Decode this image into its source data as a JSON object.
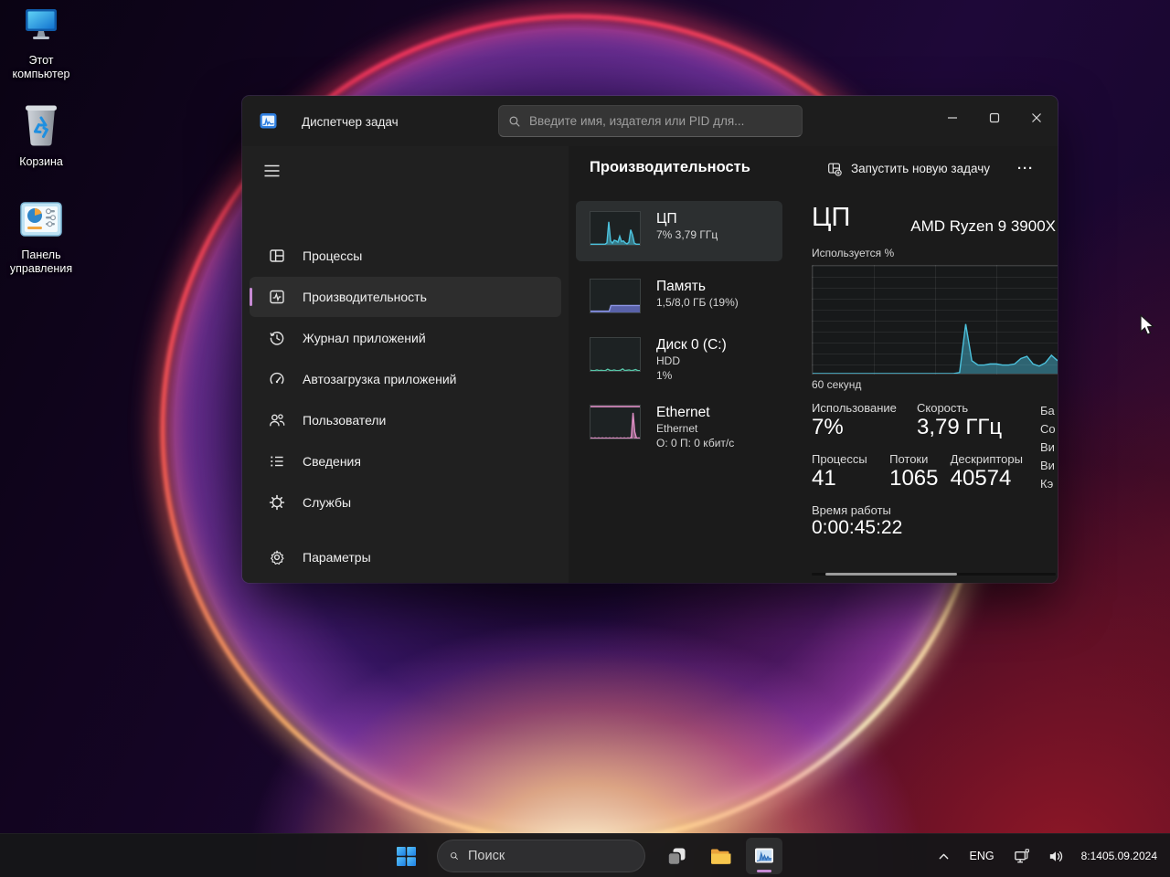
{
  "accent": "#c78ad4",
  "colors": {
    "cpu": "#4cc2dd",
    "memory": "#7c85db",
    "disk": "#57c6a8",
    "ethernet": "#e08fc6"
  },
  "desktop": {
    "icons": [
      {
        "label": "Этот компьютер"
      },
      {
        "label": "Корзина"
      },
      {
        "label": "Панель управления"
      }
    ]
  },
  "tm": {
    "title": "Диспетчер задач",
    "search_placeholder": "Введите имя, издателя или PID для...",
    "nav": {
      "items": [
        {
          "label": "Процессы"
        },
        {
          "label": "Производительность"
        },
        {
          "label": "Журнал приложений"
        },
        {
          "label": "Автозагрузка приложений"
        },
        {
          "label": "Пользователи"
        },
        {
          "label": "Сведения"
        },
        {
          "label": "Службы"
        }
      ],
      "settings": "Параметры"
    },
    "header": {
      "title": "Производительность",
      "new_task": "Запустить новую задачу",
      "more": "···"
    },
    "cards": [
      {
        "title": "ЦП",
        "line2": "7% 3,79 ГГц"
      },
      {
        "title": "Память",
        "line2": "1,5/8,0 ГБ (19%)"
      },
      {
        "title": "Диск 0 (C:)",
        "line2": "HDD",
        "line3": "1%"
      },
      {
        "title": "Ethernet",
        "line2": "Ethernet",
        "line3": "О: 0 П: 0 кбит/с"
      }
    ],
    "cpu": {
      "title": "ЦП",
      "subtitle": "AMD Ryzen 9 3900X",
      "y_label": "Используется %",
      "x_label": "60 секунд",
      "stats": {
        "usage_label": "Использование",
        "usage": "7%",
        "speed_label": "Скорость",
        "speed": "3,79 ГГц",
        "processes_label": "Процессы",
        "processes": "41",
        "threads_label": "Потоки",
        "threads": "1065",
        "handles_label": "Дескрипторы",
        "handles": "40574",
        "uptime_label": "Время работы",
        "uptime": "0:00:45:22"
      },
      "clipped_labels": [
        "Ба",
        "Со",
        "Ви",
        "Ви",
        "Кэ"
      ]
    }
  },
  "taskbar": {
    "search_placeholder": "Поиск",
    "lang": "ENG",
    "time": "8:14",
    "date": "05.09.2024"
  },
  "chart_data": [
    {
      "id": "cpu-main",
      "type": "area",
      "title": "ЦП — Используется %",
      "xlabel": "60 секунд",
      "ylabel": "Используется %",
      "ylim": [
        0,
        100
      ],
      "grid": true,
      "color": "#4cc2dd",
      "fill": "rgba(76,194,221,0.45)",
      "ymax": 100,
      "values": [
        0,
        0,
        0,
        0,
        0,
        0,
        0,
        0,
        0,
        0,
        0,
        0,
        0,
        0,
        0,
        0,
        0,
        0,
        0,
        0,
        0,
        0,
        0,
        0,
        1,
        46,
        12,
        8,
        8,
        9,
        9,
        8,
        8,
        9,
        14,
        16,
        9,
        7,
        10,
        17,
        12
      ]
    },
    {
      "id": "cpu-mini",
      "type": "area",
      "title": "ЦП 7% 3,79 ГГц",
      "ylim": [
        0,
        100
      ],
      "color": "#4cc2dd",
      "fill": "rgba(76,194,221,0.55)",
      "ymax": 100,
      "values": [
        2,
        2,
        2,
        2,
        2,
        2,
        2,
        2,
        2,
        6,
        70,
        12,
        5,
        14,
        12,
        8,
        26,
        10,
        12,
        6,
        3,
        8,
        46,
        30,
        5,
        2,
        2,
        2
      ]
    },
    {
      "id": "memory-mini",
      "type": "area",
      "title": "Память 1,5/8,0 ГБ (19%)",
      "ylim": [
        0,
        100
      ],
      "color": "#8e97e8",
      "fill": "rgba(110,120,215,0.75)",
      "ymax": 100,
      "values": [
        4,
        4,
        4,
        4,
        4,
        4,
        4,
        4,
        4,
        4,
        4,
        4,
        21,
        21,
        21,
        21,
        21,
        21,
        21,
        21,
        21,
        21,
        21,
        21,
        21,
        21,
        21,
        21,
        21,
        21
      ]
    },
    {
      "id": "disk-mini",
      "type": "line",
      "title": "Диск 0 (C:) HDD 1%",
      "ylim": [
        0,
        100
      ],
      "color": "#57c6a8",
      "ymax": 100,
      "values": [
        2,
        1,
        1,
        3,
        1,
        2,
        1,
        1,
        5,
        2,
        1,
        3,
        1,
        1,
        2,
        6,
        1,
        2,
        3,
        1,
        2,
        4,
        1,
        1
      ]
    },
    {
      "id": "ethernet-mini",
      "type": "area",
      "title": "Ethernet О: 0 П: 0 кбит/с",
      "ylim": [
        0,
        100
      ],
      "color": "#e08fc6",
      "fill": "rgba(224,143,198,0.55)",
      "ymax": 100,
      "top_line": true,
      "dotted_baseline": true,
      "values": [
        1,
        1,
        1,
        1,
        1,
        1,
        1,
        1,
        1,
        1,
        1,
        1,
        1,
        1,
        1,
        1,
        1,
        1,
        1,
        1,
        1,
        1,
        1,
        1,
        4,
        78,
        20,
        2,
        1,
        1
      ]
    }
  ]
}
